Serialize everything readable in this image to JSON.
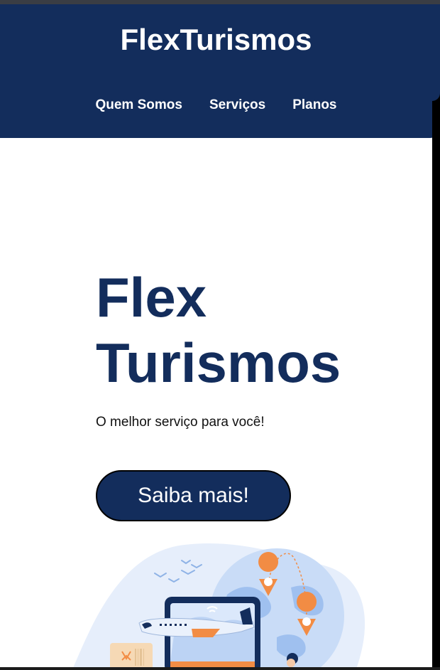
{
  "header": {
    "brand": "FlexTurismos",
    "nav": [
      {
        "label": "Quem Somos"
      },
      {
        "label": "Serviços"
      },
      {
        "label": "Planos"
      }
    ]
  },
  "hero": {
    "title_line1": "Flex",
    "title_line2": "Turismos",
    "subtitle": "O melhor serviço para você!",
    "cta_label": "Saiba mais!"
  },
  "colors": {
    "primary": "#132d5c",
    "accent": "#f28c44",
    "light_blue": "#c9dcf7",
    "white": "#ffffff"
  },
  "illustration": {
    "icons": [
      "laptop-icon",
      "airplane-icon",
      "location-pin-icon",
      "birds-icon",
      "globe-icon",
      "person-icon"
    ]
  }
}
